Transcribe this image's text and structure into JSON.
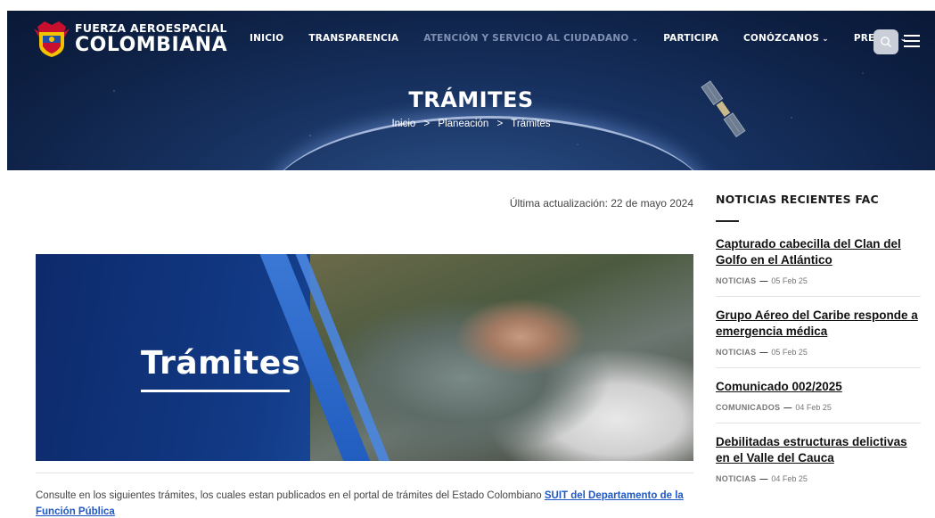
{
  "header": {
    "logo_line1": "FUERZA AEROESPACIAL",
    "logo_line2": "COLOMBIANA",
    "nav": [
      {
        "label": "INICIO",
        "dropdown": false
      },
      {
        "label": "TRANSPARENCIA",
        "dropdown": false
      },
      {
        "label": "ATENCIÓN Y SERVICIO AL CIUDADANO",
        "dropdown": true
      },
      {
        "label": "PARTICIPA",
        "dropdown": false
      },
      {
        "label": "CONÓZCANOS",
        "dropdown": true
      },
      {
        "label": "PRENSA",
        "dropdown": true
      }
    ],
    "search_icon": "search-icon",
    "menu_icon": "hamburger-icon"
  },
  "hero": {
    "title": "TRÁMITES",
    "breadcrumb": [
      "Inicio",
      "Planeación",
      "Trámites"
    ],
    "separator": ">"
  },
  "main": {
    "updated": "Última actualización: 22 de mayo 2024",
    "banner_title": "Trámites",
    "intro_text": "Consulte en los siguientes trámites, los cuales estan publicados en el portal de trámites del Estado Colombiano ",
    "intro_link": "SUIT  del Departamento de la Función Pública"
  },
  "sidebar": {
    "title": "NOTICIAS RECIENTES FAC",
    "news": [
      {
        "title": "Capturado cabecilla del Clan del Golfo en el Atlántico",
        "category": "NOTICIAS",
        "date": "05 Feb 25"
      },
      {
        "title": "Grupo Aéreo del Caribe responde a emergencia médica",
        "category": "NOTICIAS",
        "date": "05 Feb 25"
      },
      {
        "title": "Comunicado 002/2025",
        "category": "COMUNICADOS",
        "date": "04 Feb 25"
      },
      {
        "title": "Debilitadas estructuras delictivas en el Valle del Cauca",
        "category": "NOTICIAS",
        "date": "04 Feb 25"
      }
    ]
  },
  "colors": {
    "hero_dark": "#0d1f42",
    "link_blue": "#1f58c4",
    "nav_muted": "#7f90b3"
  }
}
